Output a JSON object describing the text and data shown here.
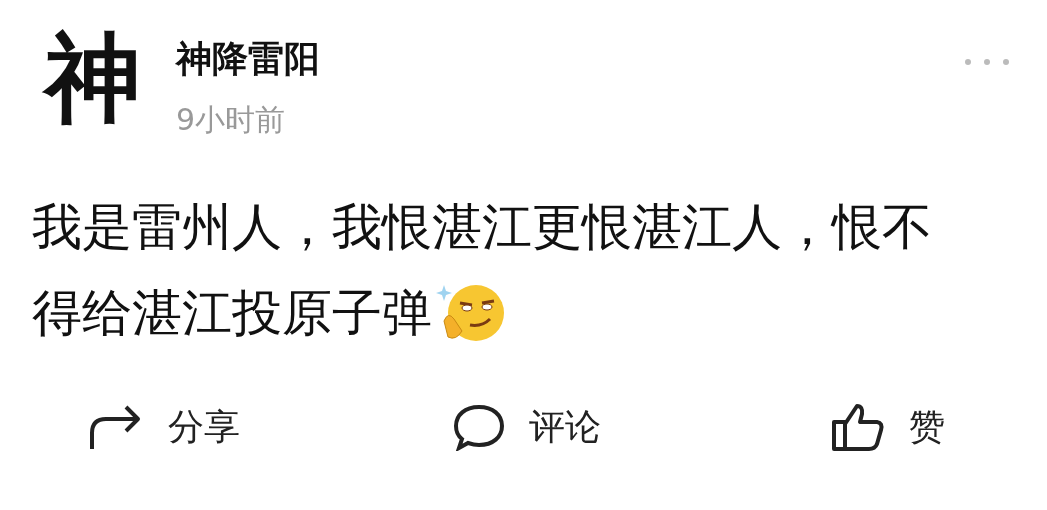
{
  "post": {
    "avatar_text": "神",
    "author": "神降雷阳",
    "time": "9小时前",
    "text_lines": [
      "我是雷州人，我恨湛江更恨湛江人，恨不",
      "得给湛江投原子弹"
    ]
  },
  "actions": [
    {
      "kind": "share",
      "label": "分享"
    },
    {
      "kind": "comment",
      "label": "评论"
    },
    {
      "kind": "like",
      "label": "赞"
    }
  ]
}
